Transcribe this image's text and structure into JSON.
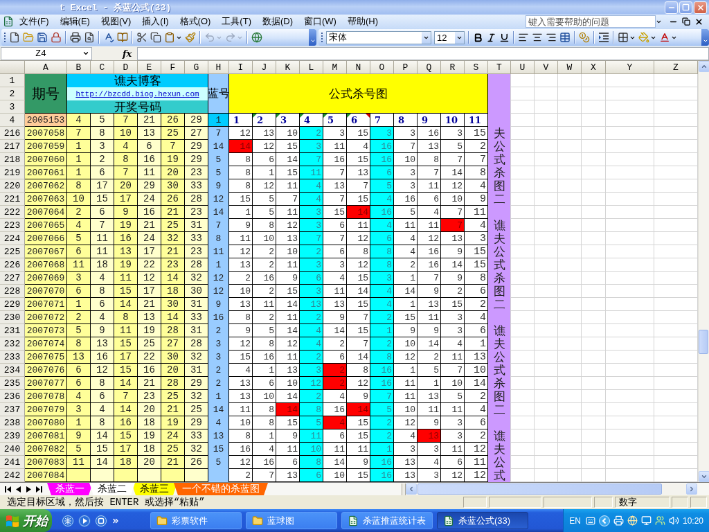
{
  "window": {
    "title": "t Excel - 杀蓝公式(33)"
  },
  "menu": [
    "文件(F)",
    "编辑(E)",
    "视图(V)",
    "插入(I)",
    "格式(O)",
    "工具(T)",
    "数据(D)",
    "窗口(W)",
    "帮助(H)"
  ],
  "help_box": {
    "placeholder": "键入需要帮助的问题"
  },
  "toolbar": {
    "undo": {
      "disabled": true
    },
    "redo": {
      "disabled": true
    },
    "font": "宋体",
    "size": "12"
  },
  "formula_bar": {
    "name_box": "Z4",
    "function_label": "fx"
  },
  "sheet": {
    "column_headers": [
      "A",
      "B",
      "C",
      "D",
      "E",
      "F",
      "G",
      "H",
      "I",
      "J",
      "K",
      "L",
      "M",
      "N",
      "O",
      "P",
      "Q",
      "R",
      "S",
      "T",
      "U",
      "V",
      "W",
      "X",
      "Y",
      "Z"
    ],
    "header_rows": [
      "1",
      "2",
      "3"
    ],
    "titles": {
      "period": "期号",
      "blog": "谯夫博客",
      "link": "http://bzcdd.biog.hexun.com",
      "draw": "开奖号码",
      "blue": "蓝号",
      "chart": "公式杀号图"
    },
    "reference_row": {
      "number": "4",
      "period": "2005153",
      "balls": [
        "4",
        "5",
        "7",
        "21",
        "26",
        "29"
      ],
      "blue": "1"
    },
    "formula_columns": [
      {
        "label": "1",
        "shaded": false,
        "error_flag": false,
        "comment": false
      },
      {
        "label": "2",
        "shaded": false,
        "error_flag": true,
        "comment": false
      },
      {
        "label": "3",
        "shaded": false,
        "error_flag": true,
        "comment": false
      },
      {
        "label": "4",
        "shaded": true,
        "error_flag": true,
        "comment": false
      },
      {
        "label": "5",
        "shaded": false,
        "error_flag": true,
        "comment": false
      },
      {
        "label": "6",
        "shaded": false,
        "error_flag": true,
        "comment": true
      },
      {
        "label": "7",
        "shaded": true,
        "error_flag": false,
        "comment": false
      },
      {
        "label": "8",
        "shaded": false,
        "error_flag": false,
        "comment": false
      },
      {
        "label": "9",
        "shaded": false,
        "error_flag": false,
        "comment": false
      },
      {
        "label": "10",
        "shaded": false,
        "error_flag": false,
        "comment": false
      },
      {
        "label": "11",
        "shaded": false,
        "error_flag": false,
        "comment": false
      }
    ],
    "rows": [
      {
        "number": "216",
        "period": "2007058",
        "balls": [
          "7",
          "8",
          "10",
          "13",
          "25",
          "27"
        ],
        "blue": "7",
        "kills": [
          {
            "value": "12",
            "hit": false
          },
          {
            "value": "13",
            "hit": false
          },
          {
            "value": "10",
            "hit": false
          },
          {
            "value": "2",
            "hit": false
          },
          {
            "value": "3",
            "hit": false
          },
          {
            "value": "15",
            "hit": false
          },
          {
            "value": "3",
            "hit": false
          },
          {
            "value": "3",
            "hit": false
          },
          {
            "value": "16",
            "hit": false
          },
          {
            "value": "3",
            "hit": false
          },
          {
            "value": "15",
            "hit": false
          }
        ]
      },
      {
        "number": "217",
        "period": "2007059",
        "balls": [
          "1",
          "3",
          "4",
          "6",
          "7",
          "29"
        ],
        "blue": "14",
        "kills": [
          {
            "value": "14",
            "hit": true
          },
          {
            "value": "12",
            "hit": false
          },
          {
            "value": "15",
            "hit": false
          },
          {
            "value": "3",
            "hit": false
          },
          {
            "value": "11",
            "hit": false
          },
          {
            "value": "4",
            "hit": false
          },
          {
            "value": "16",
            "hit": false
          },
          {
            "value": "7",
            "hit": false
          },
          {
            "value": "13",
            "hit": false
          },
          {
            "value": "5",
            "hit": false
          },
          {
            "value": "2",
            "hit": false
          }
        ]
      },
      {
        "number": "218",
        "period": "2007060",
        "balls": [
          "1",
          "2",
          "8",
          "16",
          "19",
          "29"
        ],
        "blue": "5",
        "kills": [
          {
            "value": "8",
            "hit": false
          },
          {
            "value": "6",
            "hit": false
          },
          {
            "value": "14",
            "hit": false
          },
          {
            "value": "7",
            "hit": false
          },
          {
            "value": "16",
            "hit": false
          },
          {
            "value": "15",
            "hit": false
          },
          {
            "value": "16",
            "hit": false
          },
          {
            "value": "10",
            "hit": false
          },
          {
            "value": "8",
            "hit": false
          },
          {
            "value": "7",
            "hit": false
          },
          {
            "value": "7",
            "hit": false
          }
        ]
      },
      {
        "number": "219",
        "period": "2007061",
        "balls": [
          "1",
          "6",
          "7",
          "11",
          "20",
          "23"
        ],
        "blue": "5",
        "kills": [
          {
            "value": "8",
            "hit": false
          },
          {
            "value": "1",
            "hit": false
          },
          {
            "value": "15",
            "hit": false
          },
          {
            "value": "11",
            "hit": false
          },
          {
            "value": "7",
            "hit": false
          },
          {
            "value": "13",
            "hit": false
          },
          {
            "value": "6",
            "hit": false
          },
          {
            "value": "3",
            "hit": false
          },
          {
            "value": "7",
            "hit": false
          },
          {
            "value": "14",
            "hit": false
          },
          {
            "value": "8",
            "hit": false
          }
        ]
      },
      {
        "number": "220",
        "period": "2007062",
        "balls": [
          "8",
          "17",
          "20",
          "29",
          "30",
          "33"
        ],
        "blue": "9",
        "kills": [
          {
            "value": "8",
            "hit": false
          },
          {
            "value": "12",
            "hit": false
          },
          {
            "value": "11",
            "hit": false
          },
          {
            "value": "4",
            "hit": false
          },
          {
            "value": "13",
            "hit": false
          },
          {
            "value": "7",
            "hit": false
          },
          {
            "value": "5",
            "hit": false
          },
          {
            "value": "3",
            "hit": false
          },
          {
            "value": "11",
            "hit": false
          },
          {
            "value": "12",
            "hit": false
          },
          {
            "value": "4",
            "hit": false
          }
        ]
      },
      {
        "number": "221",
        "period": "2007063",
        "balls": [
          "10",
          "15",
          "17",
          "24",
          "26",
          "28"
        ],
        "blue": "12",
        "kills": [
          {
            "value": "15",
            "hit": false
          },
          {
            "value": "5",
            "hit": false
          },
          {
            "value": "7",
            "hit": false
          },
          {
            "value": "4",
            "hit": false
          },
          {
            "value": "7",
            "hit": false
          },
          {
            "value": "15",
            "hit": false
          },
          {
            "value": "4",
            "hit": false
          },
          {
            "value": "16",
            "hit": false
          },
          {
            "value": "6",
            "hit": false
          },
          {
            "value": "10",
            "hit": false
          },
          {
            "value": "9",
            "hit": false
          }
        ]
      },
      {
        "number": "222",
        "period": "2007064",
        "balls": [
          "2",
          "6",
          "9",
          "16",
          "21",
          "23"
        ],
        "blue": "14",
        "kills": [
          {
            "value": "1",
            "hit": false
          },
          {
            "value": "5",
            "hit": false
          },
          {
            "value": "11",
            "hit": false
          },
          {
            "value": "3",
            "hit": false
          },
          {
            "value": "15",
            "hit": false
          },
          {
            "value": "14",
            "hit": true
          },
          {
            "value": "16",
            "hit": false
          },
          {
            "value": "5",
            "hit": false
          },
          {
            "value": "4",
            "hit": false
          },
          {
            "value": "7",
            "hit": false
          },
          {
            "value": "11",
            "hit": false
          }
        ]
      },
      {
        "number": "223",
        "period": "2007065",
        "balls": [
          "4",
          "7",
          "19",
          "21",
          "25",
          "31"
        ],
        "blue": "7",
        "kills": [
          {
            "value": "9",
            "hit": false
          },
          {
            "value": "8",
            "hit": false
          },
          {
            "value": "12",
            "hit": false
          },
          {
            "value": "3",
            "hit": false
          },
          {
            "value": "6",
            "hit": false
          },
          {
            "value": "11",
            "hit": false
          },
          {
            "value": "4",
            "hit": false
          },
          {
            "value": "11",
            "hit": false
          },
          {
            "value": "11",
            "hit": false
          },
          {
            "value": "7",
            "hit": true
          },
          {
            "value": "4",
            "hit": false
          }
        ]
      },
      {
        "number": "224",
        "period": "2007066",
        "balls": [
          "5",
          "11",
          "16",
          "24",
          "32",
          "33"
        ],
        "blue": "8",
        "kills": [
          {
            "value": "11",
            "hit": false
          },
          {
            "value": "10",
            "hit": false
          },
          {
            "value": "13",
            "hit": false
          },
          {
            "value": "7",
            "hit": false
          },
          {
            "value": "7",
            "hit": false
          },
          {
            "value": "12",
            "hit": false
          },
          {
            "value": "6",
            "hit": false
          },
          {
            "value": "4",
            "hit": false
          },
          {
            "value": "12",
            "hit": false
          },
          {
            "value": "13",
            "hit": false
          },
          {
            "value": "3",
            "hit": false
          }
        ]
      },
      {
        "number": "225",
        "period": "2007067",
        "balls": [
          "6",
          "11",
          "13",
          "17",
          "21",
          "23"
        ],
        "blue": "11",
        "kills": [
          {
            "value": "12",
            "hit": false
          },
          {
            "value": "2",
            "hit": false
          },
          {
            "value": "10",
            "hit": false
          },
          {
            "value": "2",
            "hit": false
          },
          {
            "value": "6",
            "hit": false
          },
          {
            "value": "8",
            "hit": false
          },
          {
            "value": "8",
            "hit": false
          },
          {
            "value": "4",
            "hit": false
          },
          {
            "value": "16",
            "hit": false
          },
          {
            "value": "9",
            "hit": false
          },
          {
            "value": "15",
            "hit": false
          }
        ]
      },
      {
        "number": "226",
        "period": "2007068",
        "balls": [
          "11",
          "18",
          "19",
          "22",
          "23",
          "28"
        ],
        "blue": "1",
        "kills": [
          {
            "value": "13",
            "hit": false
          },
          {
            "value": "2",
            "hit": false
          },
          {
            "value": "11",
            "hit": false
          },
          {
            "value": "3",
            "hit": false
          },
          {
            "value": "3",
            "hit": false
          },
          {
            "value": "12",
            "hit": false
          },
          {
            "value": "8",
            "hit": false
          },
          {
            "value": "2",
            "hit": false
          },
          {
            "value": "16",
            "hit": false
          },
          {
            "value": "14",
            "hit": false
          },
          {
            "value": "15",
            "hit": false
          }
        ]
      },
      {
        "number": "227",
        "period": "2007069",
        "balls": [
          "3",
          "4",
          "11",
          "12",
          "14",
          "32"
        ],
        "blue": "12",
        "kills": [
          {
            "value": "2",
            "hit": false
          },
          {
            "value": "16",
            "hit": false
          },
          {
            "value": "9",
            "hit": false
          },
          {
            "value": "6",
            "hit": false
          },
          {
            "value": "4",
            "hit": false
          },
          {
            "value": "15",
            "hit": false
          },
          {
            "value": "3",
            "hit": false
          },
          {
            "value": "1",
            "hit": false
          },
          {
            "value": "7",
            "hit": false
          },
          {
            "value": "9",
            "hit": false
          },
          {
            "value": "8",
            "hit": false
          }
        ]
      },
      {
        "number": "228",
        "period": "2007070",
        "balls": [
          "6",
          "8",
          "15",
          "17",
          "18",
          "30"
        ],
        "blue": "12",
        "kills": [
          {
            "value": "10",
            "hit": false
          },
          {
            "value": "2",
            "hit": false
          },
          {
            "value": "15",
            "hit": false
          },
          {
            "value": "3",
            "hit": false
          },
          {
            "value": "11",
            "hit": false
          },
          {
            "value": "14",
            "hit": false
          },
          {
            "value": "4",
            "hit": false
          },
          {
            "value": "14",
            "hit": false
          },
          {
            "value": "9",
            "hit": false
          },
          {
            "value": "2",
            "hit": false
          },
          {
            "value": "6",
            "hit": false
          }
        ]
      },
      {
        "number": "229",
        "period": "2007071",
        "balls": [
          "1",
          "6",
          "14",
          "21",
          "30",
          "31"
        ],
        "blue": "9",
        "kills": [
          {
            "value": "13",
            "hit": false
          },
          {
            "value": "11",
            "hit": false
          },
          {
            "value": "14",
            "hit": false
          },
          {
            "value": "13",
            "hit": false
          },
          {
            "value": "13",
            "hit": false
          },
          {
            "value": "15",
            "hit": false
          },
          {
            "value": "4",
            "hit": false
          },
          {
            "value": "1",
            "hit": false
          },
          {
            "value": "13",
            "hit": false
          },
          {
            "value": "15",
            "hit": false
          },
          {
            "value": "2",
            "hit": false
          }
        ]
      },
      {
        "number": "230",
        "period": "2007072",
        "balls": [
          "2",
          "4",
          "8",
          "13",
          "14",
          "33"
        ],
        "blue": "16",
        "kills": [
          {
            "value": "8",
            "hit": false
          },
          {
            "value": "2",
            "hit": false
          },
          {
            "value": "11",
            "hit": false
          },
          {
            "value": "2",
            "hit": false
          },
          {
            "value": "9",
            "hit": false
          },
          {
            "value": "7",
            "hit": false
          },
          {
            "value": "2",
            "hit": false
          },
          {
            "value": "15",
            "hit": false
          },
          {
            "value": "11",
            "hit": false
          },
          {
            "value": "3",
            "hit": false
          },
          {
            "value": "4",
            "hit": false
          }
        ]
      },
      {
        "number": "231",
        "period": "2007073",
        "balls": [
          "5",
          "9",
          "11",
          "19",
          "28",
          "31"
        ],
        "blue": "2",
        "kills": [
          {
            "value": "9",
            "hit": false
          },
          {
            "value": "5",
            "hit": false
          },
          {
            "value": "14",
            "hit": false
          },
          {
            "value": "4",
            "hit": false
          },
          {
            "value": "14",
            "hit": false
          },
          {
            "value": "15",
            "hit": false
          },
          {
            "value": "1",
            "hit": false
          },
          {
            "value": "9",
            "hit": false
          },
          {
            "value": "9",
            "hit": false
          },
          {
            "value": "3",
            "hit": false
          },
          {
            "value": "6",
            "hit": false
          }
        ]
      },
      {
        "number": "232",
        "period": "2007074",
        "balls": [
          "8",
          "13",
          "15",
          "25",
          "27",
          "28"
        ],
        "blue": "3",
        "kills": [
          {
            "value": "12",
            "hit": false
          },
          {
            "value": "8",
            "hit": false
          },
          {
            "value": "12",
            "hit": false
          },
          {
            "value": "4",
            "hit": false
          },
          {
            "value": "2",
            "hit": false
          },
          {
            "value": "7",
            "hit": false
          },
          {
            "value": "2",
            "hit": false
          },
          {
            "value": "10",
            "hit": false
          },
          {
            "value": "14",
            "hit": false
          },
          {
            "value": "4",
            "hit": false
          },
          {
            "value": "1",
            "hit": false
          }
        ]
      },
      {
        "number": "233",
        "period": "2007075",
        "balls": [
          "13",
          "16",
          "17",
          "22",
          "30",
          "32"
        ],
        "blue": "3",
        "kills": [
          {
            "value": "15",
            "hit": false
          },
          {
            "value": "16",
            "hit": false
          },
          {
            "value": "11",
            "hit": false
          },
          {
            "value": "2",
            "hit": false
          },
          {
            "value": "6",
            "hit": false
          },
          {
            "value": "14",
            "hit": false
          },
          {
            "value": "8",
            "hit": false
          },
          {
            "value": "12",
            "hit": false
          },
          {
            "value": "2",
            "hit": false
          },
          {
            "value": "11",
            "hit": false
          },
          {
            "value": "13",
            "hit": false
          }
        ]
      },
      {
        "number": "234",
        "period": "2007076",
        "balls": [
          "6",
          "12",
          "15",
          "16",
          "20",
          "31"
        ],
        "blue": "2",
        "kills": [
          {
            "value": "4",
            "hit": false
          },
          {
            "value": "1",
            "hit": false
          },
          {
            "value": "13",
            "hit": false
          },
          {
            "value": "3",
            "hit": false
          },
          {
            "value": "2",
            "hit": true
          },
          {
            "value": "8",
            "hit": false
          },
          {
            "value": "16",
            "hit": false
          },
          {
            "value": "1",
            "hit": false
          },
          {
            "value": "5",
            "hit": false
          },
          {
            "value": "7",
            "hit": false
          },
          {
            "value": "10",
            "hit": false
          }
        ]
      },
      {
        "number": "235",
        "period": "2007077",
        "balls": [
          "6",
          "8",
          "14",
          "21",
          "28",
          "29"
        ],
        "blue": "2",
        "kills": [
          {
            "value": "13",
            "hit": false
          },
          {
            "value": "6",
            "hit": false
          },
          {
            "value": "10",
            "hit": false
          },
          {
            "value": "12",
            "hit": false
          },
          {
            "value": "2",
            "hit": true
          },
          {
            "value": "12",
            "hit": false
          },
          {
            "value": "16",
            "hit": false
          },
          {
            "value": "11",
            "hit": false
          },
          {
            "value": "1",
            "hit": false
          },
          {
            "value": "10",
            "hit": false
          },
          {
            "value": "14",
            "hit": false
          }
        ]
      },
      {
        "number": "236",
        "period": "2007078",
        "balls": [
          "4",
          "6",
          "7",
          "23",
          "25",
          "32"
        ],
        "blue": "1",
        "kills": [
          {
            "value": "13",
            "hit": false
          },
          {
            "value": "10",
            "hit": false
          },
          {
            "value": "14",
            "hit": false
          },
          {
            "value": "2",
            "hit": false
          },
          {
            "value": "4",
            "hit": false
          },
          {
            "value": "9",
            "hit": false
          },
          {
            "value": "7",
            "hit": false
          },
          {
            "value": "11",
            "hit": false
          },
          {
            "value": "13",
            "hit": false
          },
          {
            "value": "5",
            "hit": false
          },
          {
            "value": "2",
            "hit": false
          }
        ]
      },
      {
        "number": "237",
        "period": "2007079",
        "balls": [
          "3",
          "4",
          "14",
          "20",
          "21",
          "25"
        ],
        "blue": "14",
        "kills": [
          {
            "value": "11",
            "hit": false
          },
          {
            "value": "8",
            "hit": false
          },
          {
            "value": "14",
            "hit": true
          },
          {
            "value": "8",
            "hit": false
          },
          {
            "value": "16",
            "hit": false
          },
          {
            "value": "14",
            "hit": true
          },
          {
            "value": "5",
            "hit": false
          },
          {
            "value": "10",
            "hit": false
          },
          {
            "value": "11",
            "hit": false
          },
          {
            "value": "11",
            "hit": false
          },
          {
            "value": "4",
            "hit": false
          }
        ]
      },
      {
        "number": "238",
        "period": "2007080",
        "balls": [
          "1",
          "8",
          "16",
          "18",
          "19",
          "29"
        ],
        "blue": "4",
        "kills": [
          {
            "value": "10",
            "hit": false
          },
          {
            "value": "8",
            "hit": false
          },
          {
            "value": "15",
            "hit": false
          },
          {
            "value": "5",
            "hit": false
          },
          {
            "value": "4",
            "hit": true
          },
          {
            "value": "15",
            "hit": false
          },
          {
            "value": "2",
            "hit": false
          },
          {
            "value": "12",
            "hit": false
          },
          {
            "value": "9",
            "hit": false
          },
          {
            "value": "3",
            "hit": false
          },
          {
            "value": "6",
            "hit": false
          }
        ]
      },
      {
        "number": "239",
        "period": "2007081",
        "balls": [
          "9",
          "14",
          "15",
          "19",
          "24",
          "33"
        ],
        "blue": "13",
        "kills": [
          {
            "value": "8",
            "hit": false
          },
          {
            "value": "1",
            "hit": false
          },
          {
            "value": "9",
            "hit": false
          },
          {
            "value": "11",
            "hit": false
          },
          {
            "value": "6",
            "hit": false
          },
          {
            "value": "15",
            "hit": false
          },
          {
            "value": "2",
            "hit": false
          },
          {
            "value": "4",
            "hit": false
          },
          {
            "value": "13",
            "hit": true
          },
          {
            "value": "3",
            "hit": false
          },
          {
            "value": "2",
            "hit": false
          }
        ]
      },
      {
        "number": "240",
        "period": "2007082",
        "balls": [
          "5",
          "15",
          "17",
          "18",
          "25",
          "32"
        ],
        "blue": "15",
        "kills": [
          {
            "value": "16",
            "hit": false
          },
          {
            "value": "4",
            "hit": false
          },
          {
            "value": "11",
            "hit": false
          },
          {
            "value": "10",
            "hit": false
          },
          {
            "value": "11",
            "hit": false
          },
          {
            "value": "11",
            "hit": false
          },
          {
            "value": "1",
            "hit": false
          },
          {
            "value": "3",
            "hit": false
          },
          {
            "value": "3",
            "hit": false
          },
          {
            "value": "11",
            "hit": false
          },
          {
            "value": "12",
            "hit": false
          }
        ]
      },
      {
        "number": "241",
        "period": "2007083",
        "balls": [
          "11",
          "14",
          "18",
          "20",
          "21",
          "26"
        ],
        "blue": "5",
        "kills": [
          {
            "value": "12",
            "hit": false
          },
          {
            "value": "16",
            "hit": false
          },
          {
            "value": "6",
            "hit": false
          },
          {
            "value": "8",
            "hit": false
          },
          {
            "value": "14",
            "hit": false
          },
          {
            "value": "9",
            "hit": false
          },
          {
            "value": "16",
            "hit": false
          },
          {
            "value": "13",
            "hit": false
          },
          {
            "value": "4",
            "hit": false
          },
          {
            "value": "6",
            "hit": false
          },
          {
            "value": "11",
            "hit": false
          }
        ]
      },
      {
        "number": "242",
        "period": "2007084",
        "kills": [
          {
            "value": "2",
            "hit": false
          },
          {
            "value": "7",
            "hit": false
          },
          {
            "value": "13",
            "hit": false
          },
          {
            "value": "6",
            "hit": false
          },
          {
            "value": "10",
            "hit": false
          },
          {
            "value": "15",
            "hit": false
          },
          {
            "value": "16",
            "hit": false
          },
          {
            "value": "13",
            "hit": false
          },
          {
            "value": "3",
            "hit": false
          },
          {
            "value": "12",
            "hit": false
          },
          {
            "value": "12",
            "hit": false
          }
        ]
      }
    ],
    "side_notes": [
      "夫公式杀图二",
      "谯夫公式杀图二",
      "谯夫公式杀图二",
      "谯夫公式"
    ]
  },
  "sheet_tabs": [
    {
      "label": "杀蓝一",
      "color": "#ff00ff",
      "selected": false
    },
    {
      "label": "杀蓝二",
      "selected": true
    },
    {
      "label": "杀蓝三",
      "color": "#ffff00",
      "selected": false
    },
    {
      "label": "一个不错的杀蓝图",
      "color": "#ff6600",
      "selected": false
    }
  ],
  "status_bar": {
    "message": "选定目标区域，然后按 ENTER 或选择“粘贴”",
    "mode": "数字"
  },
  "taskbar": {
    "start": "开始",
    "tasks": [
      {
        "label": "彩票软件",
        "kind": "folder",
        "selected": false
      },
      {
        "label": "蓝球图",
        "kind": "folder",
        "selected": false
      },
      {
        "label": "杀蓝推蓝统计表",
        "kind": "spreadsheet",
        "selected": false
      },
      {
        "label": "杀蓝公式(33)",
        "kind": "spreadsheet",
        "selected": true
      }
    ],
    "language": "EN",
    "clock": "10:20"
  }
}
